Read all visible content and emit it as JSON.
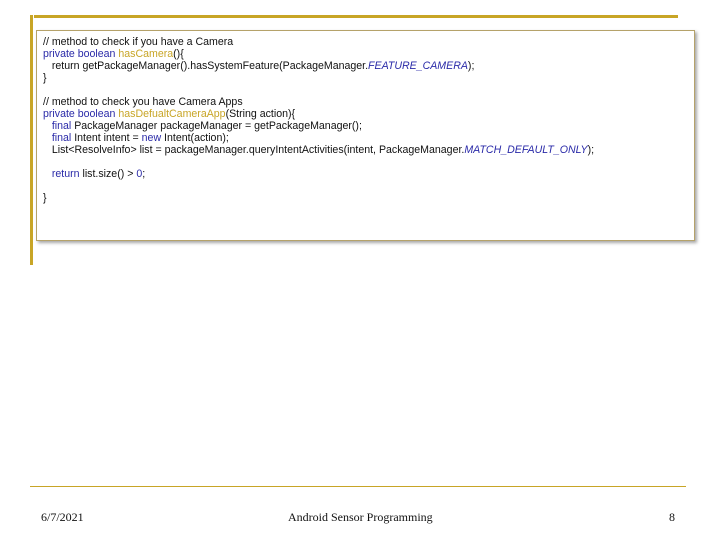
{
  "code": {
    "c1_comment": "// method to check if you have a Camera",
    "c1_decl_kw": "private boolean ",
    "c1_decl_name": "hasCamera",
    "c1_decl_tail": "(){",
    "c1_ret": "   return getPackageManager().hasSystemFeature(PackageManager.",
    "c1_ret_const": "FEATURE_CAMERA",
    "c1_ret_tail": ");",
    "c1_close": "}",
    "c2_comment": "// method to check you have Camera Apps",
    "c2_decl_kw": "private boolean ",
    "c2_decl_name": "hasDefualtCameraApp",
    "c2_decl_tail": "(String action){",
    "c2_l1_kw": "   final",
    "c2_l1_rest": " PackageManager packageManager = getPackageManager();",
    "c2_l2_kw": "   final",
    "c2_l2_mid": " Intent intent = ",
    "c2_l2_new": "new",
    "c2_l2_tail": " Intent(action);",
    "c2_l3": "   List<ResolveInfo> list = packageManager.queryIntentActivities(intent, PackageManager.",
    "c2_l3_const": "MATCH_DEFAULT_ONLY",
    "c2_l3_tail": ");",
    "c2_ret_kw": "   return",
    "c2_ret_mid": " list.size() > ",
    "c2_ret_num": "0",
    "c2_ret_tail": ";",
    "c2_close": "}"
  },
  "footer": {
    "date": "6/7/2021",
    "title": "Android Sensor Programming",
    "page": "8"
  },
  "colors": {
    "accent_gold": "#c8a526",
    "keyword_blue": "#2a2aa8"
  }
}
